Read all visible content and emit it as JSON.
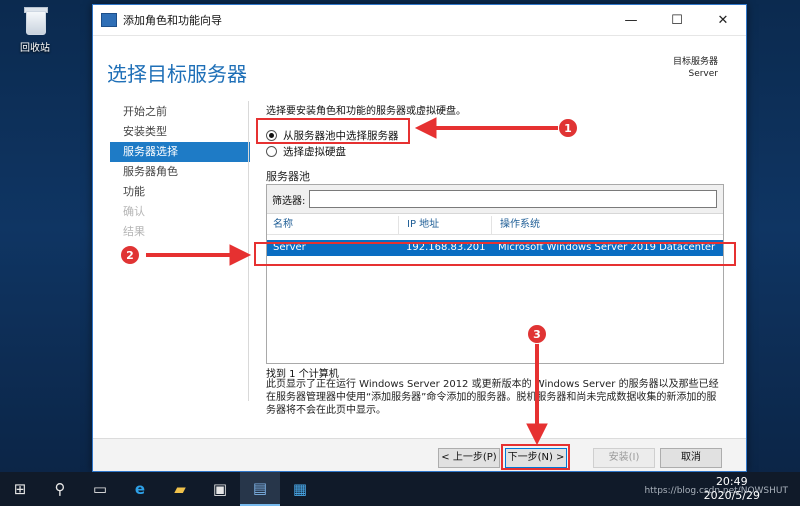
{
  "desktop": {
    "recycle_bin_label": "回收站"
  },
  "window": {
    "title": "添加角色和功能向导",
    "controls": {
      "minimize": "—",
      "maximize": "☐",
      "close": "✕"
    },
    "page_title": "选择目标服务器",
    "destination": {
      "label": "目标服务器",
      "value": "Server"
    }
  },
  "nav": {
    "items": [
      {
        "label": "开始之前",
        "state": "normal"
      },
      {
        "label": "安装类型",
        "state": "normal"
      },
      {
        "label": "服务器选择",
        "state": "active"
      },
      {
        "label": "服务器角色",
        "state": "normal"
      },
      {
        "label": "功能",
        "state": "normal"
      },
      {
        "label": "确认",
        "state": "disabled"
      },
      {
        "label": "结果",
        "state": "disabled"
      }
    ]
  },
  "content": {
    "intro": "选择要安装角色和功能的服务器或虚拟硬盘。",
    "radio_pool": "从服务器池中选择服务器",
    "radio_vhd": "选择虚拟硬盘",
    "pool_title": "服务器池",
    "filter_label": "筛选器:",
    "filter_value": "",
    "columns": {
      "name": "名称",
      "ip": "IP 地址",
      "os": "操作系统"
    },
    "rows": [
      {
        "name": "Server",
        "ip": "192.168.83.201",
        "os": "Microsoft Windows Server 2019 Datacenter"
      }
    ],
    "found": "找到 1 个计算机",
    "description": "此页显示了正在运行 Windows Server 2012 或更新版本的 Windows Server 的服务器以及那些已经在服务器管理器中使用“添加服务器”命令添加的服务器。脱机服务器和尚未完成数据收集的新添加的服务器将不会在此页中显示。"
  },
  "footer": {
    "prev": "< 上一步(P)",
    "next": "下一步(N) >",
    "install": "安装(I)",
    "cancel": "取消"
  },
  "annotations": {
    "badge1": "1",
    "badge2": "2",
    "badge3": "3",
    "color": "#e03434"
  },
  "taskbar": {
    "icons": [
      "windows-start-icon",
      "search-icon",
      "task-view-icon",
      "internet-explorer-icon",
      "file-explorer-icon",
      "cmd-icon",
      "server-manager-icon",
      "network-icon"
    ],
    "clock_time": "20:49",
    "clock_date": "2020/5/29",
    "watermark": "https://blog.csdn.net/NOWSHUT"
  }
}
